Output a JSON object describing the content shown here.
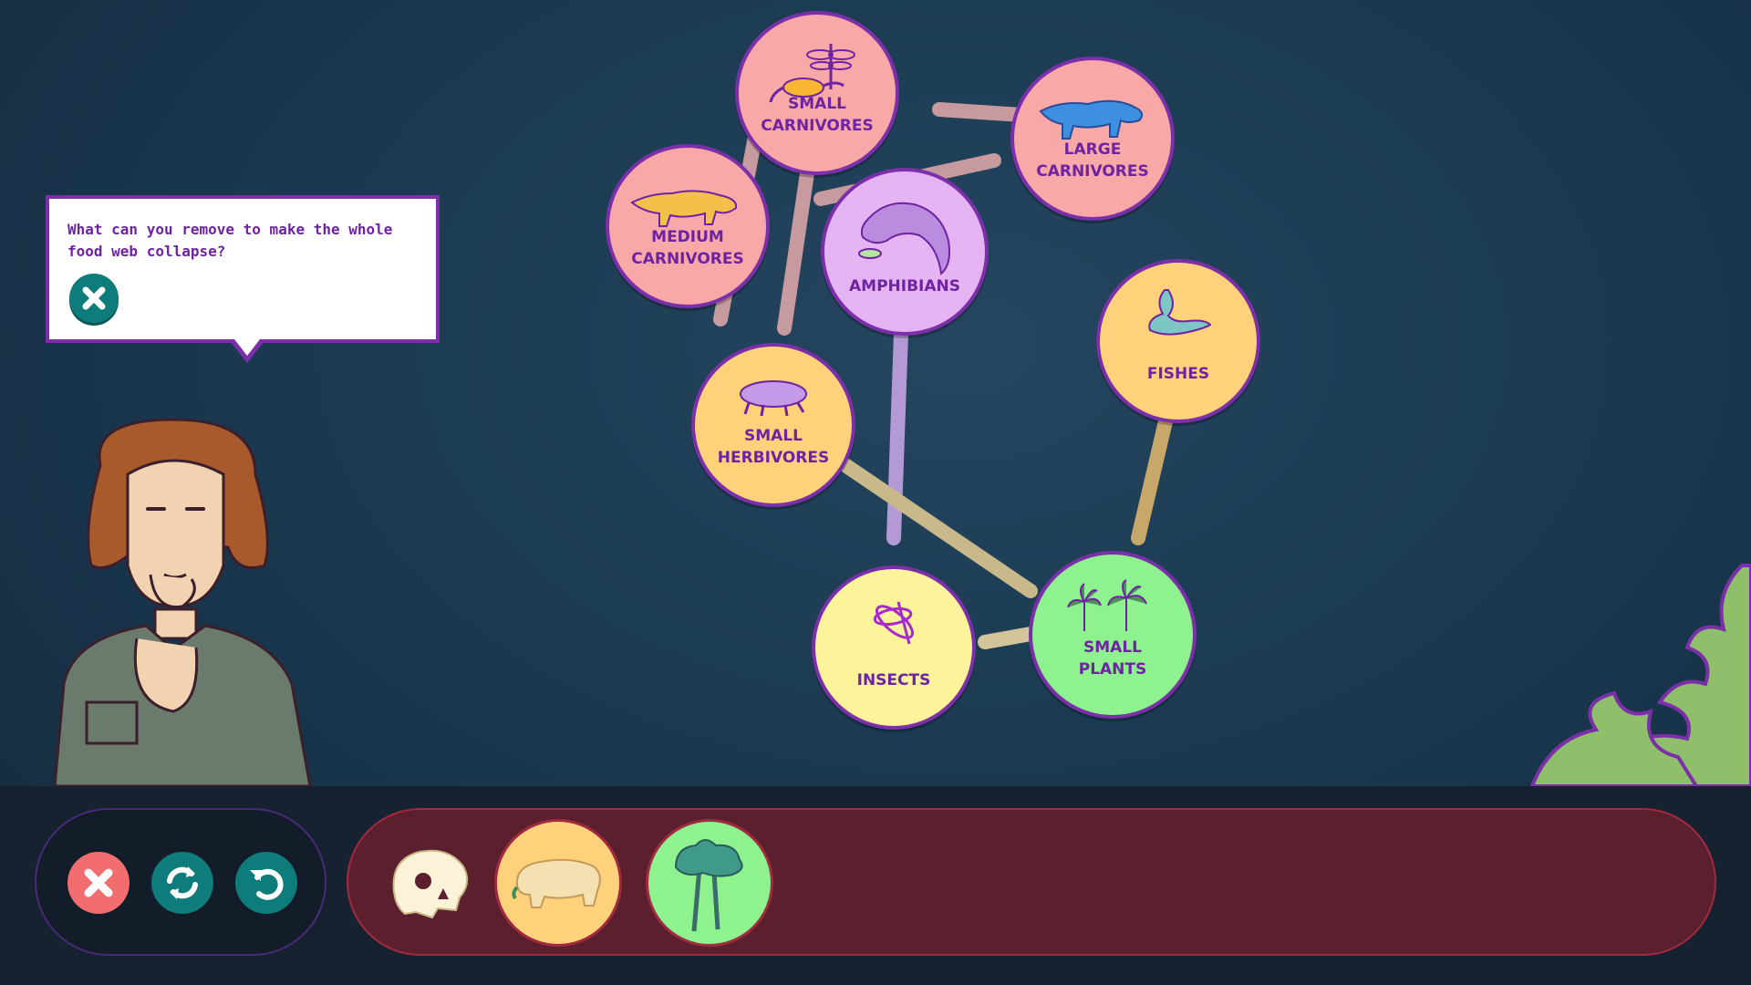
{
  "food_web": {
    "nodes": [
      {
        "id": "small-carnivores",
        "label": "SMALL\nCARNIVORES",
        "color": "#f9a8a8",
        "icon": "lizard-dragonfly-icon"
      },
      {
        "id": "large-carnivores",
        "label": "LARGE\nCARNIVORES",
        "color": "#f9a8a8",
        "icon": "large-reptile-icon"
      },
      {
        "id": "medium-carnivores",
        "label": "MEDIUM\nCARNIVORES",
        "color": "#f9a8a8",
        "icon": "medium-reptile-icon"
      },
      {
        "id": "amphibians",
        "label": "AMPHIBIANS",
        "color": "#e6b4f2",
        "icon": "amphibian-icon"
      },
      {
        "id": "fishes",
        "label": "FISHES",
        "color": "#fdd27a",
        "icon": "fish-icon"
      },
      {
        "id": "small-herbivores",
        "label": "SMALL\nHERBIVORES",
        "color": "#fdd27a",
        "icon": "small-herbivore-icon"
      },
      {
        "id": "insects",
        "label": "INSECTS",
        "color": "#fdf39a",
        "icon": "insect-icon"
      },
      {
        "id": "small-plants",
        "label": "SMALL PLANTS",
        "color": "#8ef28e",
        "icon": "small-plants-icon"
      }
    ]
  },
  "speech_bubble": {
    "text": "What can you remove to make the whole food web collapse?",
    "close_icon": "close-icon"
  },
  "controls": {
    "close_icon": "close-icon",
    "shuffle_icon": "refresh-icon",
    "undo_icon": "undo-icon",
    "close_color": "#f26d6d",
    "teal_color": "#0e7c7b"
  },
  "removed_tray": {
    "items": [
      {
        "icon": "skull-icon"
      },
      {
        "icon": "herbivore-icon",
        "color": "#fdd27a"
      },
      {
        "icon": "tree-icon",
        "color": "#8ef28e"
      }
    ]
  }
}
